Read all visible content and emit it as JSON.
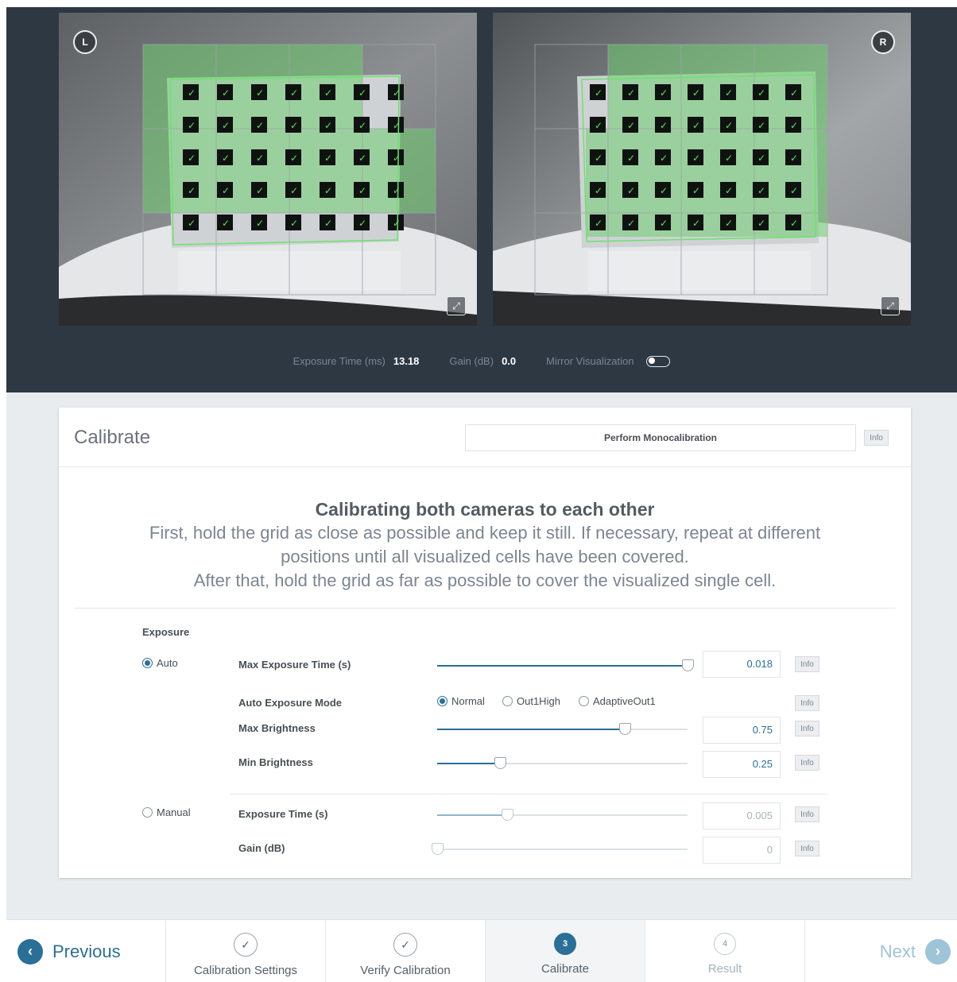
{
  "cameras": {
    "left": {
      "badge": "L",
      "expand_icon": "⤢"
    },
    "right": {
      "badge": "R",
      "expand_icon": "⤢"
    }
  },
  "params": {
    "exposure_label": "Exposure Time (ms)",
    "exposure_value": "13.18",
    "gain_label": "Gain (dB)",
    "gain_value": "0.0",
    "mirror_label": "Mirror Visualization"
  },
  "card": {
    "title": "Calibrate",
    "mono_button": "Perform Monocalibration",
    "info": "Info",
    "instructions": {
      "heading": "Calibrating both cameras to each other",
      "line1": "First, hold the grid as close as possible and keep it still. If necessary, repeat at different",
      "line2": "positions until all visualized cells have been covered.",
      "line3": "After that, hold the grid as far as possible to cover the visualized single cell."
    }
  },
  "exposure": {
    "section_label": "Exposure",
    "auto_label": "Auto",
    "manual_label": "Manual",
    "auto_mode": "auto",
    "rows": {
      "max_exposure": {
        "label": "Max Exposure Time (s)",
        "value": "0.018",
        "fraction": 1.0
      },
      "auto_mode": {
        "label": "Auto Exposure Mode",
        "options": [
          "Normal",
          "Out1High",
          "AdaptiveOut1"
        ],
        "selected": "Normal"
      },
      "max_brightness": {
        "label": "Max Brightness",
        "value": "0.75",
        "fraction": 0.75
      },
      "min_brightness": {
        "label": "Min Brightness",
        "value": "0.25",
        "fraction": 0.25
      },
      "exposure_time": {
        "label": "Exposure Time (s)",
        "value": "0.005",
        "fraction": 0.28
      },
      "gain": {
        "label": "Gain (dB)",
        "value": "0",
        "fraction": 0.0
      }
    }
  },
  "wizard": {
    "previous": "Previous",
    "next": "Next",
    "steps": [
      {
        "label": "Calibration Settings",
        "state": "done",
        "marker": "✓"
      },
      {
        "label": "Verify Calibration",
        "state": "done",
        "marker": "✓"
      },
      {
        "label": "Calibrate",
        "state": "active",
        "marker": "3"
      },
      {
        "label": "Result",
        "state": "todo",
        "marker": "4"
      }
    ]
  },
  "colors": {
    "accent": "#2a6f97",
    "dark_bg": "#2d3843",
    "overlay_green": "#7fd17f"
  }
}
